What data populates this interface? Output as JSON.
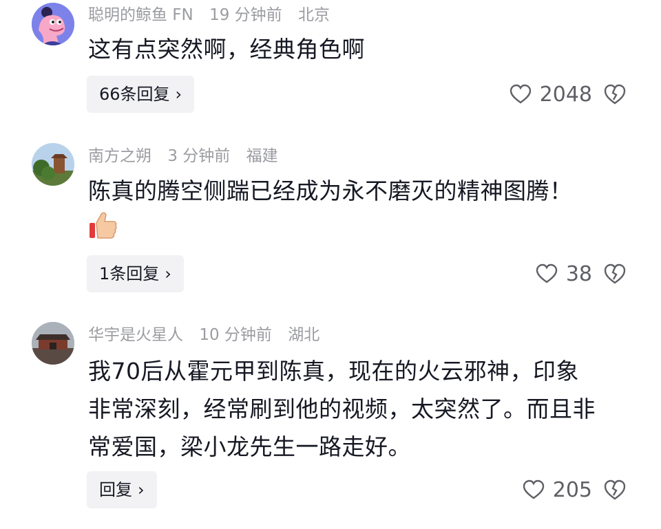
{
  "comments": [
    {
      "username": "聪明的鲸鱼 FN",
      "time": "19 分钟前",
      "location": "北京",
      "lines": [
        "这有点突然啊，经典角色啊"
      ],
      "reply_label": "66条回复",
      "likes": "2048",
      "avatar_icon": "cartoon-pink-character-avatar"
    },
    {
      "username": "南方之朔",
      "time": "3 分钟前",
      "location": "福建",
      "lines": [
        "陈真的腾空侧踹已经成为永不磨灭的精神图腾！"
      ],
      "emoji": "thumbs-up-emoji",
      "reply_label": "1条回复",
      "likes": "38",
      "avatar_icon": "pavilion-photo-avatar"
    },
    {
      "username": "华宇是火星人",
      "time": "10 分钟前",
      "location": "湖北",
      "lines": [
        "我70后从霍元甲到陈真，现在的火云邪神，印象",
        "非常深刻，经常刷到他的视频，太突然了。而且非",
        "常爱国，梁小龙先生一路走好。"
      ],
      "reply_label": "回复",
      "likes": "205",
      "avatar_icon": "gate-photo-avatar"
    }
  ],
  "icons": {
    "like": "heart-icon",
    "dislike": "broken-heart-icon",
    "chevron": "chevron-right-icon"
  },
  "colors": {
    "meta_gray": "#9b9ca1",
    "text_dark": "#161823",
    "button_bg": "#f2f2f4",
    "count_gray": "#5f6066"
  }
}
